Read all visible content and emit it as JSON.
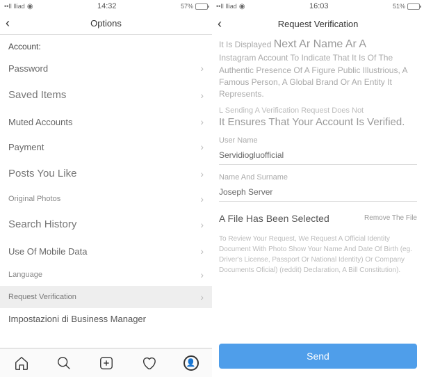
{
  "left": {
    "status": {
      "carrier": "••Il Iliad",
      "time": "14:32",
      "battery_pct": "57%",
      "battery_fill": 57
    },
    "nav": {
      "title": "Options"
    },
    "section": "Account:",
    "rows": [
      {
        "label": "Password",
        "size": "md"
      },
      {
        "label": "Saved Items",
        "size": "lg"
      },
      {
        "label": "Muted Accounts",
        "size": "md"
      },
      {
        "label": "Payment",
        "size": "md"
      },
      {
        "label": "Posts You Like",
        "size": "lg"
      },
      {
        "label": "Original Photos",
        "size": "sm"
      },
      {
        "label": "Search History",
        "size": "lg"
      },
      {
        "label": "Use Of Mobile Data",
        "size": "md"
      },
      {
        "label": "Language",
        "size": "sm"
      },
      {
        "label": "Request Verification",
        "size": "sm",
        "highlight": true
      }
    ],
    "truncated": "Impostazioni di Business Manager"
  },
  "right": {
    "status": {
      "carrier": "••Il Iliad",
      "time": "16:03",
      "battery_pct": "51%",
      "battery_fill": 51
    },
    "nav": {
      "title": "Request Verification"
    },
    "intro_parts": {
      "p1a": "It Is Displayed",
      "p1b": "Next Ar Name Ar A",
      "p2": "Instagram Account To Indicate That It Is Of The Authentic Presence Of A Figure Public Illustrious, A Famous Person, A Global Brand Or An Entity It Represents."
    },
    "note1": "L Sending A Verification Request Does Not",
    "note2": "It Ensures That Your Account Is Verified.",
    "fields": {
      "username_label": "User Name",
      "username_value": "Servidiogluofficial",
      "fullname_label": "Name And Surname",
      "fullname_value": "Joseph Server"
    },
    "file": {
      "selected": "A File Has Been Selected",
      "remove": "Remove The File"
    },
    "review": "To Review Your Request, We Request A Official Identity Document With Photo Show Your Name And Date Of Birth (eg. Driver's License, Passport Or National Identity) Or Company Documents Oficial) (reddit) Declaration, A Bill Constitution).",
    "send": "Send"
  }
}
